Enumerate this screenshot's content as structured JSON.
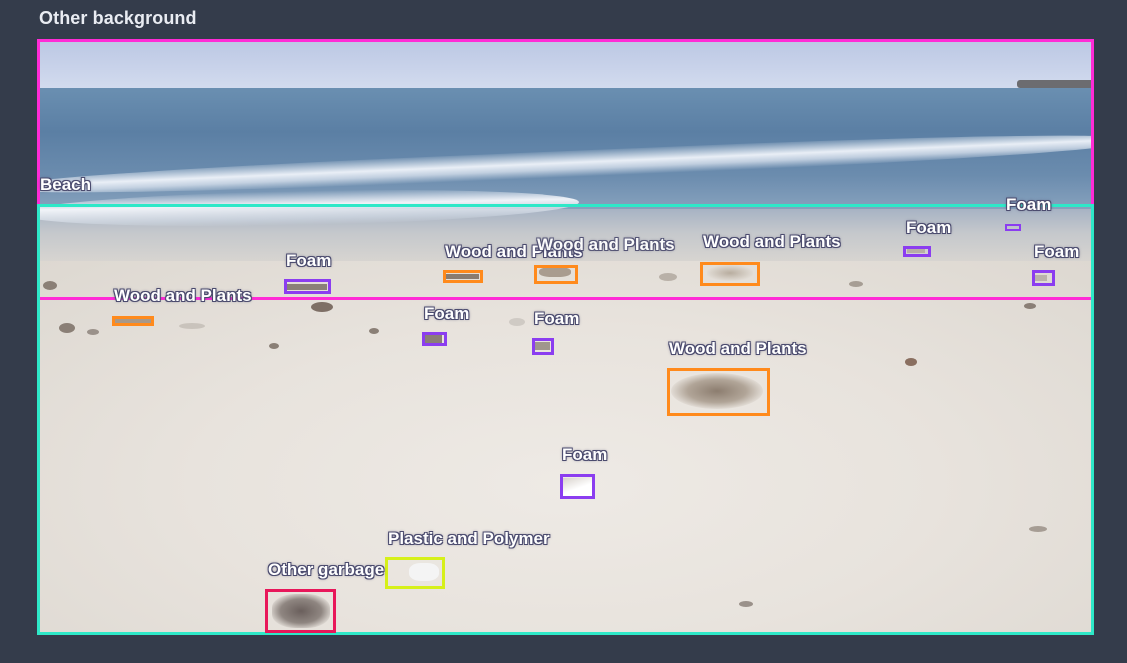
{
  "panel": {
    "title": "Other background"
  },
  "colors": {
    "other_background": "#ff2bd6",
    "beach": "#2ee8c8",
    "foam": "#8b3df0",
    "wood_and_plants": "#ff8a1c",
    "plastic_and_polymer": "#d6f019",
    "other_garbage": "#e8175a"
  },
  "annotations": {
    "beach": "Beach",
    "foam_1": "Foam",
    "foam_2": "Foam",
    "foam_3": "Foam",
    "foam_4": "Foam",
    "foam_5": "Foam",
    "foam_6": "Foam",
    "foam_7": "Foam",
    "wood_1": "Wood and Plants",
    "wood_2": "Wood and Plants",
    "wood_3": "Wood and Plants",
    "wood_4": "Wood and Plants",
    "wood_5": "Wood and Plants",
    "plastic_1": "Plastic and Polymer",
    "garbage_1": "Other garbage"
  }
}
